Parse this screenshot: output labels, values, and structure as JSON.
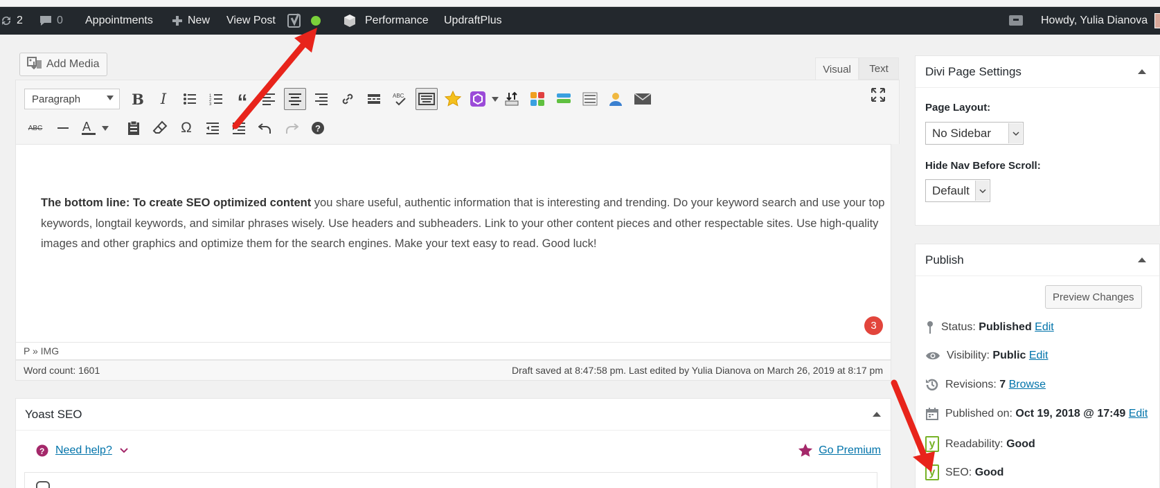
{
  "adminbar": {
    "updates_count": "2",
    "comments_count": "0",
    "appointments": "Appointments",
    "new_label": "New",
    "view_post": "View Post",
    "performance": "Performance",
    "updraftplus": "UpdraftPlus",
    "howdy": "Howdy, Yulia Dianova"
  },
  "editor": {
    "add_media": "Add Media",
    "tab_visual": "Visual",
    "tab_text": "Text",
    "format_select": "Paragraph",
    "content_bold": "The bottom line: To create SEO optimized content",
    "content_text": " you share useful, authentic information that is interesting and trending. Do your keyword search and use your top keywords, longtail keywords, and similar phrases wisely. Use headers and subheaders. Link to your other content pieces and other respectable sites. Use high-quality images and other graphics and optimize them for the search engines.  Make your text easy to read. Good luck!",
    "notification_count": "3",
    "path": "P » IMG",
    "word_count": "Word count: 1601",
    "draft_status": "Draft saved at 8:47:58 pm. Last edited by Yulia Dianova on March 26, 2019 at 8:17 pm"
  },
  "yoast": {
    "title": "Yoast SEO",
    "need_help": "Need help?",
    "go_premium": "Go Premium"
  },
  "divi": {
    "title": "Divi Page Settings",
    "page_layout_label": "Page Layout:",
    "page_layout_value": "No Sidebar",
    "hide_nav_label": "Hide Nav Before Scroll:",
    "hide_nav_value": "Default"
  },
  "publish": {
    "title": "Publish",
    "preview_changes": "Preview Changes",
    "status_label": "Status:",
    "status_value": "Published",
    "visibility_label": "Visibility:",
    "visibility_value": "Public",
    "revisions_label": "Revisions:",
    "revisions_value": "7",
    "browse": "Browse",
    "published_on_label": "Published on:",
    "published_on_value": "Oct 19, 2018 @ 17:49",
    "edit": "Edit",
    "readability_label": "Readability:",
    "readability_value": "Good",
    "seo_label": "SEO:",
    "seo_value": "Good"
  },
  "colors": {
    "adminbar_bg": "#23282d",
    "link": "#0073aa",
    "annotation_arrow": "#e8241b",
    "yoast_green": "#77b227",
    "status_dot": "#7ad03a"
  }
}
